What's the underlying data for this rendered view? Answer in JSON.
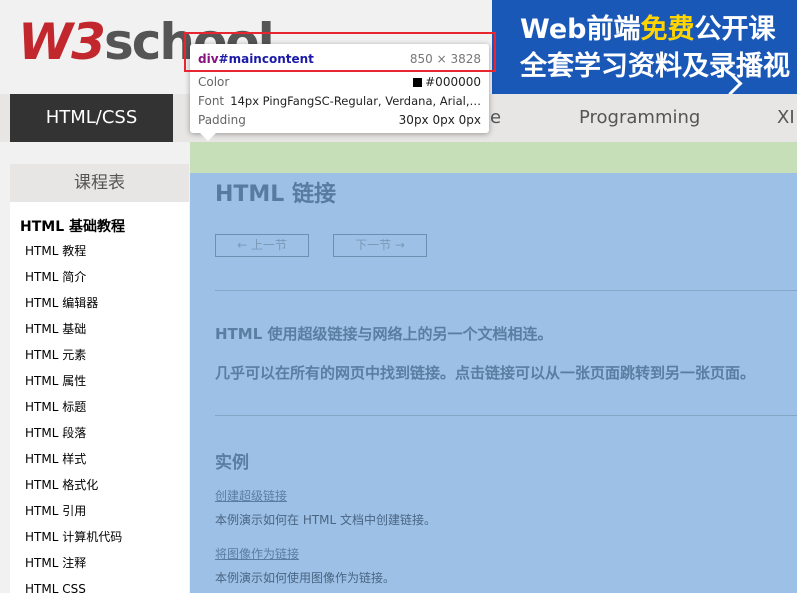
{
  "header": {
    "logo_w3": "W3",
    "logo_school": "school",
    "banner": {
      "line1_before": "Web前端",
      "line1_highlight": "免费",
      "line1_after": "公开课",
      "line2": "全套学习资料及录播视"
    }
  },
  "nav": {
    "items": [
      {
        "label": "HTML/CSS",
        "active": true
      },
      {
        "label": "e"
      },
      {
        "label": "Programming"
      },
      {
        "label": "XI"
      }
    ]
  },
  "sidebar": {
    "title": "课程表",
    "section": "HTML 基础教程",
    "items": [
      "HTML 教程",
      "HTML 简介",
      "HTML 编辑器",
      "HTML 基础",
      "HTML 元素",
      "HTML 属性",
      "HTML 标题",
      "HTML 段落",
      "HTML 样式",
      "HTML 格式化",
      "HTML 引用",
      "HTML 计算机代码",
      "HTML 注释",
      "HTML CSS"
    ]
  },
  "main": {
    "title": "HTML 链接",
    "prev": "← 上一节",
    "next": "下一节 →",
    "intro1": "HTML 使用超级链接与网络上的另一个文档相连。",
    "intro2": "几乎可以在所有的网页中找到链接。点击链接可以从一张页面跳转到另一张页面。",
    "examples_heading": "实例",
    "examples": [
      {
        "link": "创建超级链接",
        "desc": "本例演示如何在 HTML 文档中创建链接。"
      },
      {
        "link": "将图像作为链接",
        "desc": "本例演示如何使用图像作为链接。"
      }
    ]
  },
  "devtools_tooltip": {
    "selector_tag": "div",
    "selector_id": "#maincontent",
    "dimensions": "850 × 3828",
    "color_label": "Color",
    "color_value": "#000000",
    "color_swatch": "#000000",
    "font_label": "Font",
    "font_value": "14px PingFangSC-Regular, Verdana, Arial,…",
    "padding_label": "Padding",
    "padding_value": "30px 0px 0px"
  },
  "colors": {
    "highlight_overlay": "#9dc1e6",
    "padding_overlay": "#c7dfb8",
    "annotation_box": "#e8262f",
    "logo_red": "#c1272d",
    "banner_bg": "#1a58b8"
  }
}
